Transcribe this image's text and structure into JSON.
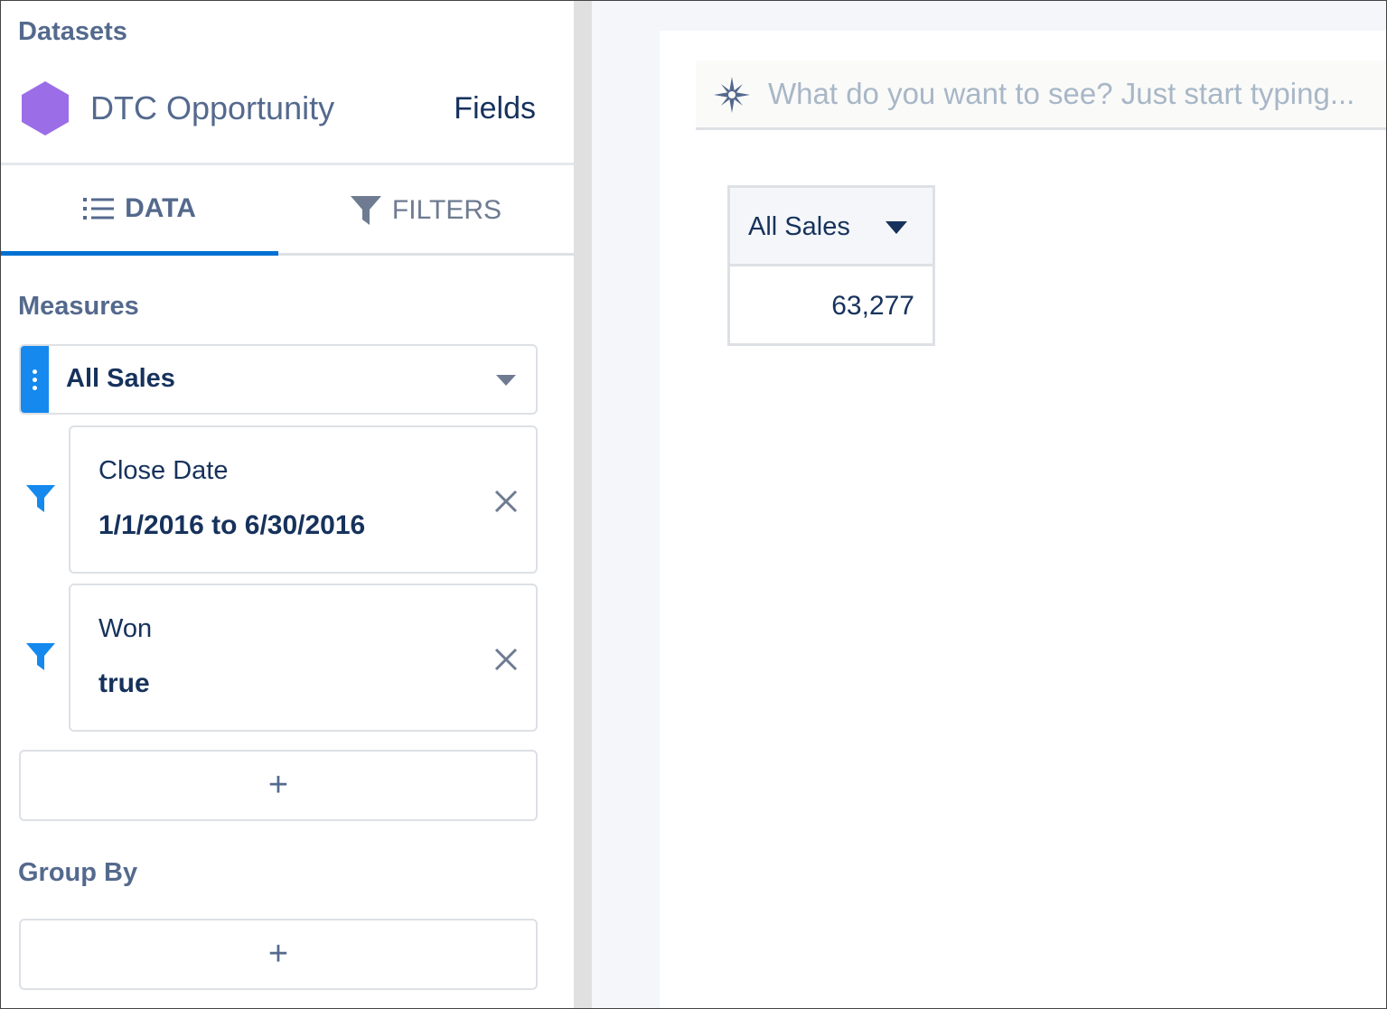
{
  "sidebar": {
    "datasets_label": "Datasets",
    "dataset_name": "DTC Opportunity",
    "fields_link": "Fields",
    "tabs": [
      {
        "label": "DATA",
        "active": true
      },
      {
        "label": "FILTERS",
        "active": false
      }
    ],
    "measures_label": "Measures",
    "measure": {
      "label": "All Sales"
    },
    "filters": [
      {
        "field": "Close Date",
        "value": "1/1/2016 to 6/30/2016"
      },
      {
        "field": "Won",
        "value": "true"
      }
    ],
    "add_symbol": "+",
    "group_by_label": "Group By"
  },
  "query": {
    "placeholder": "What do you want to see? Just start typing..."
  },
  "result": {
    "column_header": "All Sales",
    "value": "63,277"
  },
  "colors": {
    "accent": "#0070d2",
    "handle": "#1589ee",
    "dataset_icon": "#9b6ee8",
    "filter_icon": "#1589ee",
    "text_primary": "#16325c",
    "text_secondary": "#54698d"
  },
  "icons": {
    "dataset": "hexagon-icon",
    "data_tab": "list-icon",
    "filters_tab": "funnel-icon",
    "filter_row": "funnel-icon",
    "remove": "close-icon",
    "query": "sparkle-icon"
  }
}
